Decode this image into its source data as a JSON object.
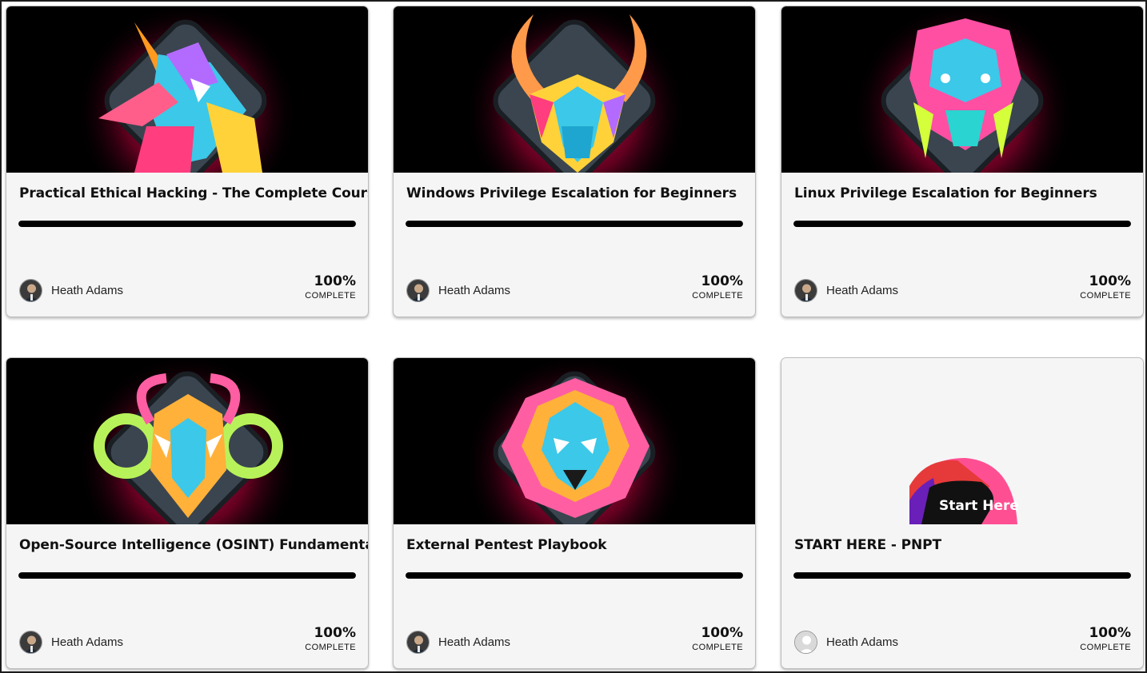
{
  "colors": {
    "accent": "#ff1f6e",
    "progress": "#000000",
    "card_bg": "#f5f5f5"
  },
  "courses": [
    {
      "title": "Practical Ethical Hacking - The Complete Course",
      "author": "Heath Adams",
      "progress": 1.0,
      "percent_text": "100%",
      "status": "COMPLETE",
      "thumbnail_icon": "jackal-mascot-icon"
    },
    {
      "title": "Windows Privilege Escalation for Beginners",
      "author": "Heath Adams",
      "progress": 1.0,
      "percent_text": "100%",
      "status": "COMPLETE",
      "thumbnail_icon": "bull-mascot-icon"
    },
    {
      "title": "Linux Privilege Escalation for Beginners",
      "author": "Heath Adams",
      "progress": 1.0,
      "percent_text": "100%",
      "status": "COMPLETE",
      "thumbnail_icon": "boar-mascot-icon"
    },
    {
      "title": "Open-Source Intelligence (OSINT) Fundamentals",
      "author": "Heath Adams",
      "progress": 1.0,
      "percent_text": "100%",
      "status": "COMPLETE",
      "thumbnail_icon": "ram-mascot-icon"
    },
    {
      "title": "External Pentest Playbook",
      "author": "Heath Adams",
      "progress": 1.0,
      "percent_text": "100%",
      "status": "COMPLETE",
      "thumbnail_icon": "lion-mascot-icon"
    },
    {
      "title": "START HERE - PNPT",
      "author": "Heath Adams",
      "progress": 1.0,
      "percent_text": "100%",
      "status": "COMPLETE",
      "thumbnail_icon": "start-here-badge-icon",
      "thumbnail_text": "Start Here"
    }
  ]
}
